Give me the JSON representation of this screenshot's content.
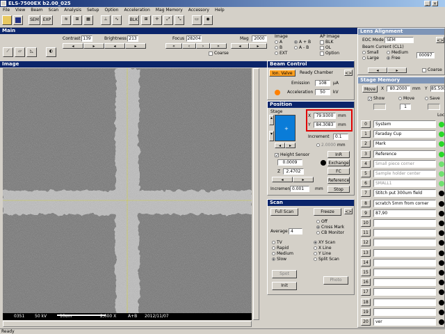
{
  "app": {
    "title": "ELS-7500EX  b2.00_025"
  },
  "menu": [
    "File",
    "View",
    "Beam",
    "Scan",
    "Analysis",
    "Setup",
    "Option",
    "Acceleration",
    "Mag Memory",
    "Accessory",
    "Help"
  ],
  "toolbar": {
    "sem": "SEM",
    "exp": "EXP",
    "blk": "BLK"
  },
  "main": {
    "title": "Main",
    "contrast_label": "Contrast",
    "contrast": "139",
    "brightness_label": "Brightness",
    "brightness": "213",
    "focus_label": "Focus",
    "focus": "28204",
    "mag_label": "Mag",
    "mag": "2000",
    "coarse_label": "Coarse",
    "image_label": "Image",
    "image_options": [
      "A",
      "A + B",
      "B",
      "A - B",
      "EXT"
    ],
    "image_selected": "A + B",
    "ap_label": "AP Image",
    "ap_options": [
      "BLK",
      "OL",
      "Option"
    ]
  },
  "image": {
    "title": "Image",
    "footer": [
      "0351",
      "50 kV",
      "10um",
      "2,000 X",
      "A+B",
      "2012/11/07"
    ]
  },
  "beam": {
    "title": "Beam Control",
    "ion_valve": "Ion. Valve",
    "status": "Ready  Chamber",
    "emission_label": "Emission",
    "emission": "108",
    "emission_unit": "µA",
    "accel_label": "Acceleration",
    "accel": "50",
    "accel_unit": "kV",
    "status_color": "#ff8000"
  },
  "position": {
    "title": "Position",
    "stage_label": "Stage",
    "x_label": "X",
    "x": "79.9300",
    "y_label": "Y",
    "y": "84.3083",
    "unit": "mm",
    "increment_label": "Increment",
    "increment": "0.1",
    "field_small": "2.0000",
    "mm": "mm",
    "height_sensor": "Height Sensor",
    "height": "0.0009",
    "z_label": "Z",
    "z": "2.4702",
    "inr": "InR",
    "exchange": "Exchange",
    "fc": "FC",
    "reference": "Reference",
    "increment2_label": "Increment",
    "increment2": "0.001",
    "stop": "Stop"
  },
  "scan": {
    "title": "Scan",
    "full_scan": "Full Scan",
    "freeze": "Freeze",
    "average_label": "Average",
    "average": "4",
    "markers": [
      "Off",
      "Cross Mark",
      "CB Monitor"
    ],
    "marker_selected": "Cross Mark",
    "speeds": [
      "TV",
      "Rapid",
      "Medium",
      "Slow"
    ],
    "speed_selected": "Slow",
    "modes": [
      "XY Scan",
      "X Line",
      "Y Line",
      "Split Scan"
    ],
    "mode_selected": "XY Scan",
    "spot": "Spot",
    "init": "Init",
    "photo": "Photo"
  },
  "lens": {
    "title": "Lens Alignment",
    "eoc_label": "EOC Mode",
    "eoc": "SEM",
    "current_label": "Beam Current (CL1)",
    "currents": [
      "Small",
      "Medium",
      "Large",
      "Free"
    ],
    "current_selected": "Free",
    "current_value": "00097",
    "coarse_label": "Coarse"
  },
  "stage_memory": {
    "title": "Stage Memory",
    "move": "Move",
    "x_label": "X",
    "x": "80.2000",
    "y_label": "Y",
    "y": "85.500",
    "show": "Show",
    "move2": "Move",
    "save": "Save",
    "index": "1",
    "lock_label": "Lock",
    "rows": [
      {
        "n": "0",
        "name": "System",
        "state": "green"
      },
      {
        "n": "1",
        "name": "Faraday Cup",
        "state": "green"
      },
      {
        "n": "2",
        "name": "Mark",
        "state": "green"
      },
      {
        "n": "3",
        "name": "Reference",
        "state": "green"
      },
      {
        "n": "4",
        "name": "Small piece corner",
        "state": "green-dim"
      },
      {
        "n": "5",
        "name": "Sample holder center",
        "state": "green-dim"
      },
      {
        "n": "6",
        "name": "SMALL1",
        "state": "green-dim"
      },
      {
        "n": "7",
        "name": "Stitch put 300um field",
        "state": "black"
      },
      {
        "n": "8",
        "name": "scratch 5mm from corner",
        "state": "black"
      },
      {
        "n": "9",
        "name": "87,90",
        "state": "black"
      },
      {
        "n": "10",
        "name": "",
        "state": "black"
      },
      {
        "n": "11",
        "name": "",
        "state": "black"
      },
      {
        "n": "12",
        "name": "",
        "state": "black"
      },
      {
        "n": "13",
        "name": "",
        "state": "black"
      },
      {
        "n": "14",
        "name": "",
        "state": "black"
      },
      {
        "n": "15",
        "name": "",
        "state": "black"
      },
      {
        "n": "16",
        "name": "",
        "state": "black"
      },
      {
        "n": "17",
        "name": "",
        "state": "black"
      },
      {
        "n": "18",
        "name": "",
        "state": "black"
      },
      {
        "n": "19",
        "name": "",
        "state": "black"
      },
      {
        "n": "20",
        "name": "ver",
        "state": "black"
      }
    ]
  },
  "status_bar": "Ready",
  "colors": {
    "highlight": "#e00000",
    "stage_view": "#0a7cd8",
    "green": "#28d828",
    "green_dim": "#70e070"
  }
}
